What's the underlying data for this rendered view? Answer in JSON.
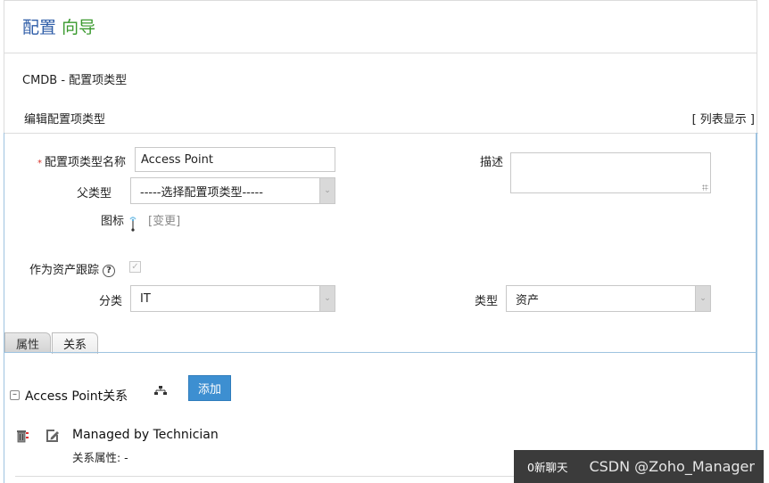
{
  "header": {
    "title_part1": "配置",
    "title_part2": "向导"
  },
  "breadcrumb": "CMDB - 配置项类型",
  "subheader": {
    "title": "编辑配置项类型",
    "list_view_link": "[ 列表显示 ]"
  },
  "form": {
    "name_label": "配置项类型名称",
    "required_mark": "*",
    "name_value": "Access Point",
    "parent_label": "父类型",
    "parent_value": "-----选择配置项类型-----",
    "icon_label": "图标",
    "icon_change_link": "[变更]",
    "description_label": "描述",
    "description_value": "",
    "track_as_asset_label": "作为资产跟踪",
    "track_as_asset_checked": true,
    "help_glyph": "?",
    "category_label": "分类",
    "category_value": "IT",
    "type_label": "类型",
    "type_value": "资产"
  },
  "tabs": [
    {
      "label": "属性",
      "active": false
    },
    {
      "label": "关系",
      "active": true
    }
  ],
  "relationships": {
    "section_title": "Access Point关系",
    "add_button": "添加",
    "items": [
      {
        "name": "Managed by Technician",
        "attributes": "关系属性: -"
      }
    ]
  },
  "chat_bar": {
    "chat_label": "0新聊天",
    "watermark": "CSDN @Zoho_Manager"
  },
  "colors": {
    "title_blue": "#2f5ea8",
    "title_green": "#3a9a2e",
    "accent_button": "#3d8fd1",
    "panel_border": "#9ec3e0",
    "required_red": "#d9342b"
  }
}
